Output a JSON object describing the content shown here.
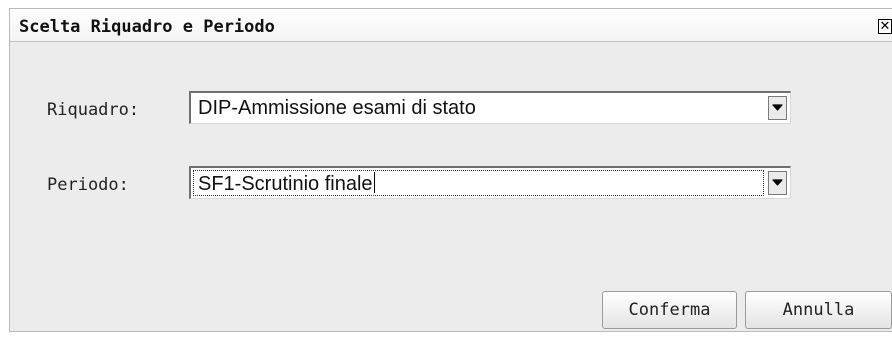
{
  "dialog": {
    "title": "Scelta Riquadro e Periodo",
    "close_icon": "close-icon"
  },
  "form": {
    "riquadro_label": "Riquadro:",
    "riquadro_value": "DIP-Ammissione esami di stato",
    "periodo_label": "Periodo:",
    "periodo_value": "SF1-Scrutinio finale"
  },
  "buttons": {
    "confirm_label": "Conferma",
    "cancel_label": "Annulla"
  },
  "icons": {
    "dropdown": "chevron-down-icon",
    "close": "close-icon"
  },
  "colors": {
    "dialog_background": "#ececec",
    "titlebar_background": "#f7f7f7"
  }
}
